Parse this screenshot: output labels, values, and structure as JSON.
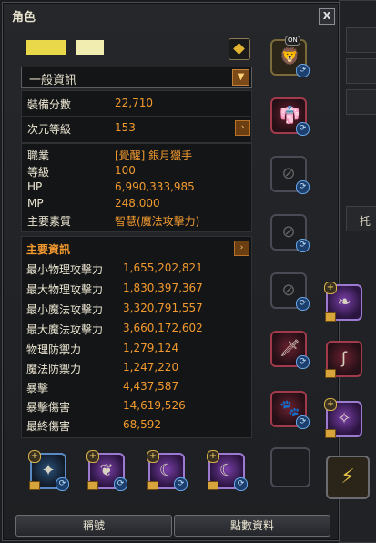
{
  "window": {
    "title": "角色",
    "close_label": "X"
  },
  "character": {
    "name_hidden": true
  },
  "dropdown": {
    "label": "一般資訊",
    "arrow": "▼"
  },
  "summary": [
    {
      "label": "裝備分數",
      "value": "22,710"
    }
  ],
  "dimension": {
    "label": "次元等級",
    "value": "153"
  },
  "basic_info": [
    {
      "label": "職業",
      "value": "[覺醒] 銀月獵手"
    },
    {
      "label": "等級",
      "value": "100"
    },
    {
      "label": "HP",
      "value": "6,990,333,985"
    },
    {
      "label": "MP",
      "value": "248,000"
    },
    {
      "label": "主要素質",
      "value": "智慧(魔法攻擊力)"
    }
  ],
  "main_section": {
    "title": "主要資訊"
  },
  "main_stats": [
    {
      "label": "最小物理攻擊力",
      "value": "1,655,202,821"
    },
    {
      "label": "最大物理攻擊力",
      "value": "1,830,397,367"
    },
    {
      "label": "最小魔法攻擊力",
      "value": "3,320,791,557"
    },
    {
      "label": "最大魔法攻擊力",
      "value": "3,660,172,602"
    },
    {
      "label": "物理防禦力",
      "value": "1,279,124"
    },
    {
      "label": "魔法防禦力",
      "value": "1,247,220"
    },
    {
      "label": "暴擊",
      "value": "4,437,587"
    },
    {
      "label": "暴擊傷害",
      "value": "14,619,526"
    },
    {
      "label": "最終傷害",
      "value": "68,592"
    }
  ],
  "badges": {
    "on": "ON",
    "plus": "+",
    "swap": "⟳"
  },
  "buttons": {
    "title_button": "稱號",
    "points_button": "點數資料"
  },
  "right_panel": {
    "tab_label": "托"
  },
  "arrow_right": "›"
}
